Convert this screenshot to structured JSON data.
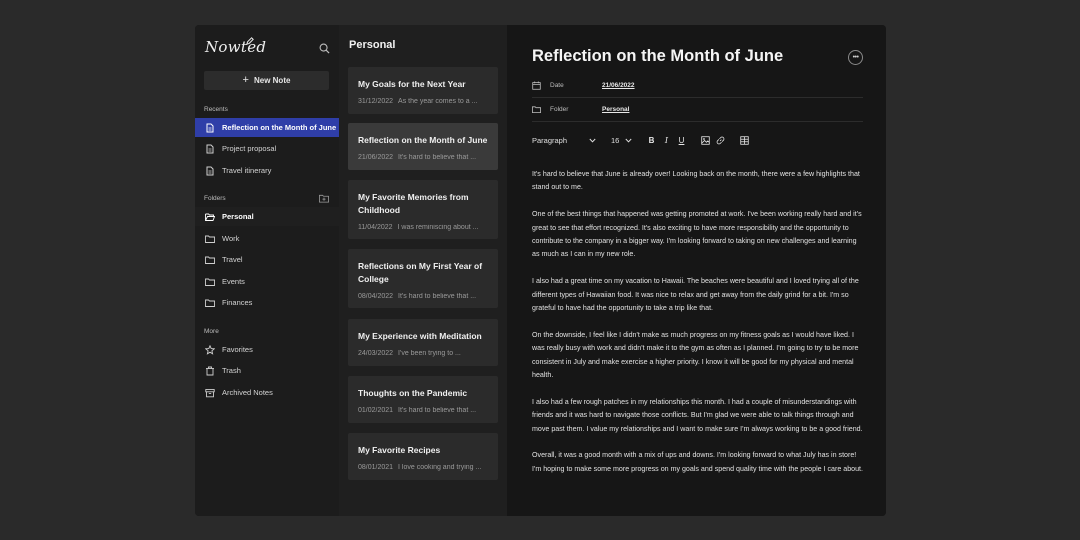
{
  "sidebar": {
    "logo": "Nowted",
    "new_note_label": "New Note",
    "recents_label": "Recents",
    "recents": [
      {
        "label": "Reflection on the Month of June",
        "icon": "note-icon"
      },
      {
        "label": "Project proposal",
        "icon": "note-icon"
      },
      {
        "label": "Travel itinerary",
        "icon": "note-icon"
      }
    ],
    "folders_label": "Folders",
    "folders": [
      {
        "label": "Personal",
        "icon": "folder-open-icon"
      },
      {
        "label": "Work",
        "icon": "folder-icon"
      },
      {
        "label": "Travel",
        "icon": "folder-icon"
      },
      {
        "label": "Events",
        "icon": "folder-icon"
      },
      {
        "label": "Finances",
        "icon": "folder-icon"
      }
    ],
    "more_label": "More",
    "more": [
      {
        "label": "Favorites",
        "icon": "star-icon"
      },
      {
        "label": "Trash",
        "icon": "trash-icon"
      },
      {
        "label": "Archived Notes",
        "icon": "archive-icon"
      }
    ]
  },
  "notes_list": {
    "title": "Personal",
    "notes": [
      {
        "title": "My Goals for the Next Year",
        "date": "31/12/2022",
        "preview": "As the year comes to a ..."
      },
      {
        "title": "Reflection on the Month of June",
        "date": "21/06/2022",
        "preview": "It's hard to believe that ..."
      },
      {
        "title": "My Favorite Memories from Childhood",
        "date": "11/04/2022",
        "preview": "I was reminiscing about ..."
      },
      {
        "title": "Reflections on My First Year of College",
        "date": "08/04/2022",
        "preview": "It's hard to believe that ..."
      },
      {
        "title": "My Experience with Meditation",
        "date": "24/03/2022",
        "preview": "I've been trying to ..."
      },
      {
        "title": "Thoughts on the Pandemic",
        "date": "01/02/2021",
        "preview": "It's hard to believe that ..."
      },
      {
        "title": "My Favorite Recipes",
        "date": "08/01/2021",
        "preview": "I love cooking and trying ..."
      }
    ]
  },
  "editor": {
    "title": "Reflection on the Month of June",
    "date_label": "Date",
    "date_value": "21/06/2022",
    "folder_label": "Folder",
    "folder_value": "Personal",
    "paragraph_style": "Paragraph",
    "font_size": "16",
    "paragraphs": [
      "It's hard to believe that June is already over! Looking back on the month, there were a few highlights that stand out to me.",
      "One of the best things that happened was getting promoted at work. I've been working really hard and it's great to see that effort recognized. It's also exciting to have more responsibility and the opportunity to contribute to the company in a bigger way. I'm looking forward to taking on new challenges and learning as much as I can in my new role.",
      "I also had a great time on my vacation to Hawaii. The beaches were beautiful and I loved trying all of the different types of Hawaiian food. It was nice to relax and get away from the daily grind for a bit. I'm so grateful to have had the opportunity to take a trip like that.",
      "On the downside, I feel like I didn't make as much progress on my fitness goals as I would have liked. I was really busy with work and didn't make it to the gym as often as I planned. I'm going to try to be more consistent in July and make exercise a higher priority. I know it will be good for my physical and mental health.",
      "I also had a few rough patches in my relationships this month. I had a couple of misunderstandings with friends and it was hard to navigate those conflicts. But I'm glad we were able to talk things through and move past them. I value my relationships and I want to make sure I'm always working to be a good friend.",
      "Overall, it was a good month with a mix of ups and downs. I'm looking forward to what July has in store! I'm hoping to make some more progress on my goals and spend quality time with the people I care about."
    ]
  },
  "colors": {
    "background": "#2a2a2a",
    "sidebar": "#1c1c1c",
    "notes_panel": "#1f1f1f",
    "editor": "#161616",
    "accent": "#2f3ea8",
    "card": "#2b2b2b",
    "card_active": "#3a3a3a"
  }
}
